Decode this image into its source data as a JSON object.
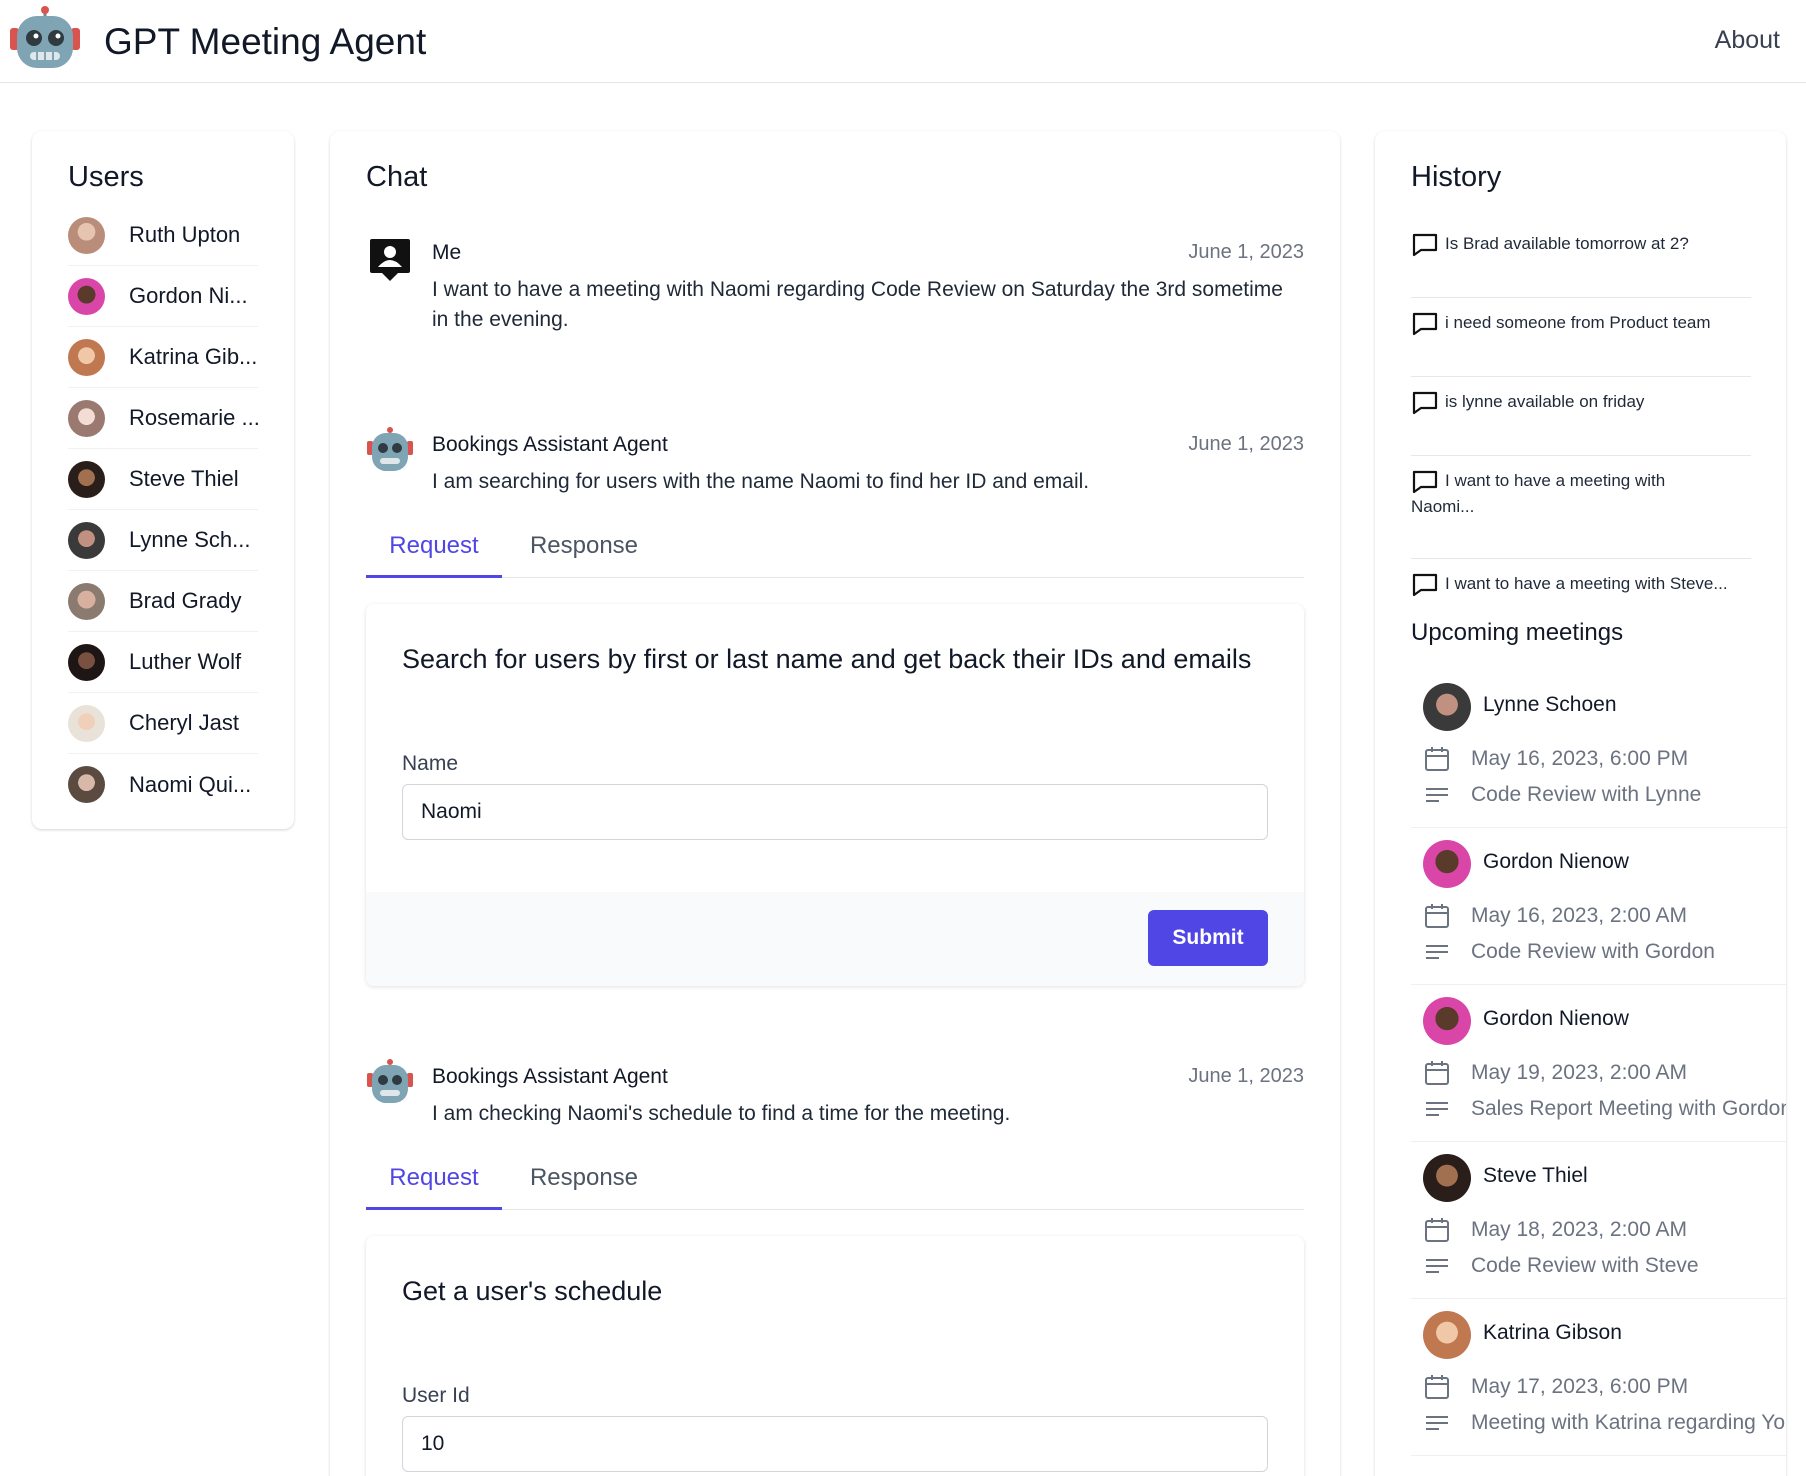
{
  "app": {
    "title": "GPT Meeting Agent",
    "about_label": "About"
  },
  "users": {
    "title": "Users",
    "items": [
      {
        "name": "Ruth Upton",
        "color": "#b98d7a"
      },
      {
        "name": "Gordon Ni...",
        "color": "#d946a8"
      },
      {
        "name": "Katrina Gib...",
        "color": "#c07850"
      },
      {
        "name": "Rosemarie ...",
        "color": "#d9b9b0"
      },
      {
        "name": "Steve Thiel",
        "color": "#3b2a24"
      },
      {
        "name": "Lynne Sch...",
        "color": "#4a4a4a"
      },
      {
        "name": "Brad Grady",
        "color": "#a08070"
      },
      {
        "name": "Luther Wolf",
        "color": "#2d2220"
      },
      {
        "name": "Cheryl Jast",
        "color": "#d8c3a5"
      },
      {
        "name": "Naomi Qui...",
        "color": "#7a6a60"
      }
    ]
  },
  "chat": {
    "title": "Chat",
    "messages": [
      {
        "sender": "Me",
        "date": "June 1, 2023",
        "text": "I want to have a meeting with Naomi regarding Code Review on Saturday the 3rd sometime in the evening."
      },
      {
        "sender": "Bookings Assistant Agent",
        "date": "June 1, 2023",
        "text": "I am searching for users with the name Naomi to find her ID and email."
      },
      {
        "sender": "Bookings Assistant Agent",
        "date": "June 1, 2023",
        "text": "I am checking Naomi's schedule to find a time for the meeting."
      }
    ],
    "tabs": {
      "request": "Request",
      "response": "Response"
    },
    "form1": {
      "heading": "Search for users by first or last name and get back their IDs and emails",
      "label": "Name",
      "value": "Naomi",
      "submit": "Submit"
    },
    "form2": {
      "heading": "Get a user's schedule",
      "label": "User Id",
      "value": "10"
    }
  },
  "history": {
    "title": "History",
    "items": [
      {
        "line1": "Is Brad available tomorrow at 2?",
        "line2": ""
      },
      {
        "line1": "i need someone from Product team",
        "line2": ""
      },
      {
        "line1": "is lynne available on friday",
        "line2": ""
      },
      {
        "line1": "I want to have a meeting with",
        "line2": "Naomi..."
      },
      {
        "line1": "I want to have a meeting with Steve...",
        "line2": ""
      }
    ],
    "upcoming_title": "Upcoming meetings",
    "meetings": [
      {
        "name": "Lynne Schoen",
        "date": "May 16, 2023, 6:00 PM",
        "subject": "Code Review with Lynne",
        "color": "#4a4a4a"
      },
      {
        "name": "Gordon Nienow",
        "date": "May 16, 2023, 2:00 AM",
        "subject": "Code Review with Gordon",
        "color": "#d946a8"
      },
      {
        "name": "Gordon Nienow",
        "date": "May 19, 2023, 2:00 AM",
        "subject": "Sales Report Meeting with Gordon",
        "color": "#d946a8"
      },
      {
        "name": "Steve Thiel",
        "date": "May 18, 2023, 2:00 AM",
        "subject": "Code Review with Steve",
        "color": "#3b2a24"
      },
      {
        "name": "Katrina Gibson",
        "date": "May 17, 2023, 6:00 PM",
        "subject": "Meeting with Katrina regarding Yo",
        "color": "#c07850"
      }
    ]
  },
  "colors": {
    "accent": "#4f46e5",
    "robot_body": "#7fa5b5",
    "robot_red": "#d9534f"
  }
}
